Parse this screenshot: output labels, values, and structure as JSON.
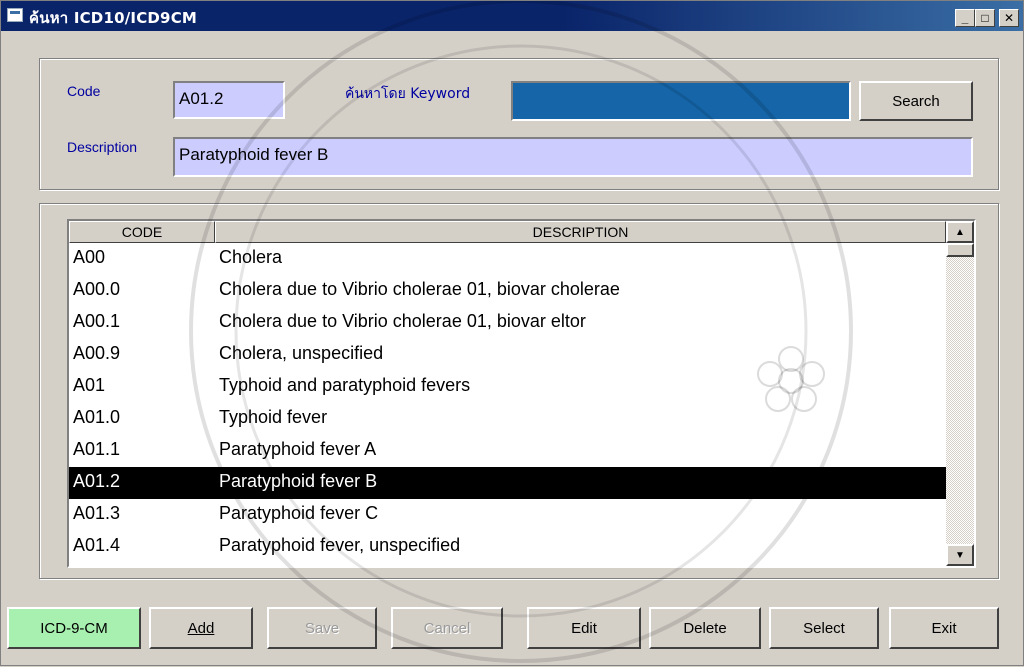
{
  "window": {
    "title": "ค้นหา ICD10/ICD9CM",
    "controls": {
      "minimize": "_",
      "maximize": "□",
      "close": "✕"
    }
  },
  "search": {
    "code_label": "Code",
    "code_value": "A01.2",
    "keyword_label": "ค้นหาโดย Keyword",
    "keyword_value": "",
    "search_button": "Search",
    "description_label": "Description",
    "description_value": "Paratyphoid fever B"
  },
  "list": {
    "columns": [
      "CODE",
      "DESCRIPTION"
    ],
    "rows": [
      {
        "code": "A00",
        "description": "Cholera"
      },
      {
        "code": "A00.0",
        "description": "Cholera due to Vibrio cholerae 01, biovar cholerae"
      },
      {
        "code": "A00.1",
        "description": "Cholera due to Vibrio cholerae 01, biovar eltor"
      },
      {
        "code": "A00.9",
        "description": "Cholera, unspecified"
      },
      {
        "code": "A01",
        "description": "Typhoid and paratyphoid fevers"
      },
      {
        "code": "A01.0",
        "description": "Typhoid fever"
      },
      {
        "code": "A01.1",
        "description": "Paratyphoid fever A"
      },
      {
        "code": "A01.2",
        "description": "Paratyphoid fever B"
      },
      {
        "code": "A01.3",
        "description": "Paratyphoid fever C"
      },
      {
        "code": "A01.4",
        "description": "Paratyphoid fever, unspecified"
      }
    ],
    "selected_index": 7
  },
  "buttons": {
    "icd9": "ICD-9-CM",
    "add": "Add",
    "save": "Save",
    "cancel": "Cancel",
    "edit": "Edit",
    "delete": "Delete",
    "select": "Select",
    "exit": "Exit"
  },
  "colors": {
    "field_bg": "#ccccff",
    "keyword_bg": "#1565a8",
    "icd9_button_bg": "#a8f0b0",
    "selection_bg": "#000000",
    "titlebar": "#0a246a"
  }
}
